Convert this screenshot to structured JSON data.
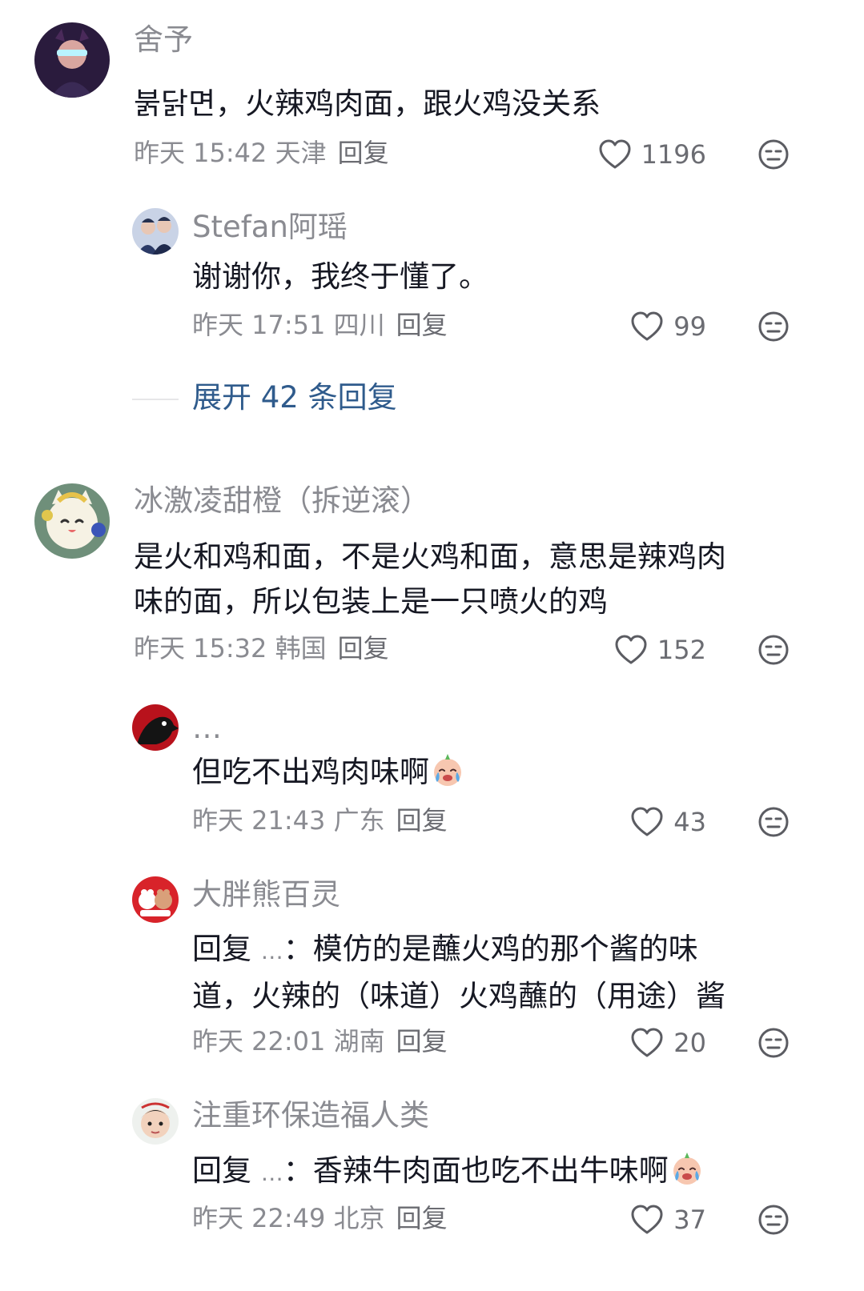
{
  "comments": [
    {
      "name": "舍予",
      "text": [
        "붉닭면，火辣鸡肉面，跟火鸡没关系"
      ],
      "time": "昨天 15:42 天津",
      "reply_label": "回复",
      "likes": "1196",
      "replies": [
        {
          "name": "Stefan阿瑶",
          "text": [
            "谢谢你，我终于懂了。"
          ],
          "time": "昨天 17:51 四川",
          "reply_label": "回复",
          "likes": "99"
        }
      ],
      "expand_label": "展开 42 条回复"
    },
    {
      "name": "冰激凌甜橙（拆逆滚）",
      "text": [
        "是火和鸡和面，不是火鸡和面，意思是辣鸡肉",
        "味的面，所以包装上是一只喷火的鸡"
      ],
      "time": "昨天 15:32 韩国",
      "reply_label": "回复",
      "likes": "152",
      "replies": [
        {
          "name": "…",
          "text": [
            "但吃不出鸡肉味啊"
          ],
          "time": "昨天 21:43 广东",
          "reply_label": "回复",
          "likes": "43"
        },
        {
          "name": "大胖熊百灵",
          "text_prefix": "回复",
          "text_target": "…",
          "text": [
            "：模仿的是蘸火鸡的那个酱的味",
            "道，火辣的（味道）火鸡蘸的（用途）酱"
          ],
          "time": "昨天 22:01 湖南",
          "reply_label": "回复",
          "likes": "20"
        },
        {
          "name": "注重环保造福人类",
          "text_prefix": "回复",
          "text_target": "…",
          "text": [
            "：香辣牛肉面也吃不出牛味啊"
          ],
          "time": "昨天 22:49 北京",
          "reply_label": "回复",
          "likes": "37"
        }
      ]
    }
  ],
  "icons": {
    "like": "heart-outline-icon",
    "dislike": "meh-face-icon",
    "emoji": "crying-face-emoji"
  },
  "colors": {
    "name": "#8a8b91",
    "body": "#161823",
    "link": "#2f5b8c",
    "icon": "#5b5c62"
  }
}
